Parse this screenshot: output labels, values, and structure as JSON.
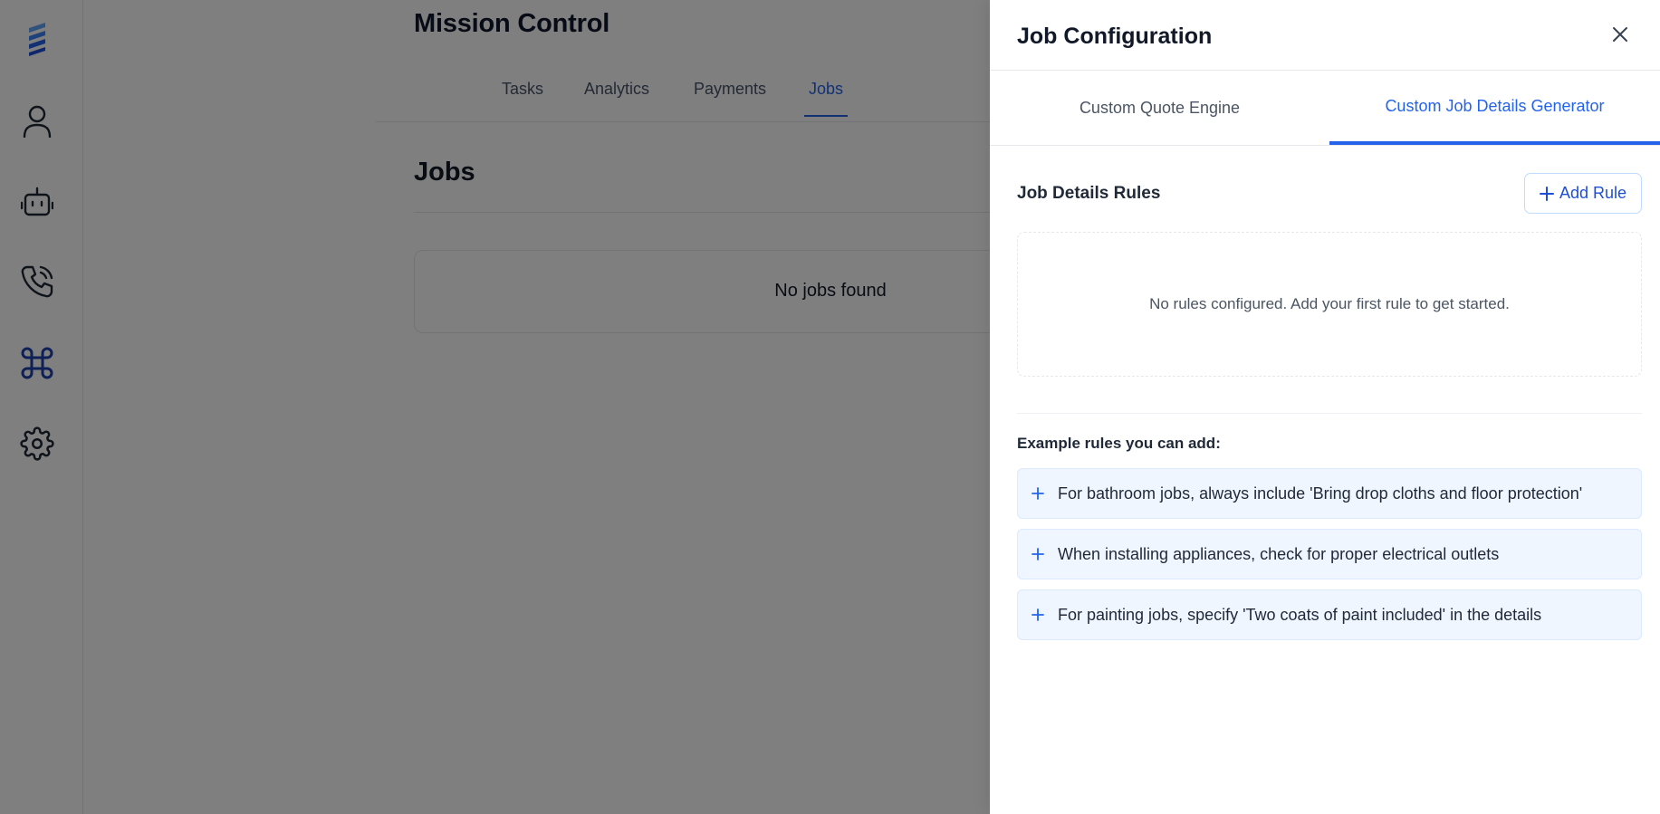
{
  "page": {
    "title": "Mission Control",
    "tabs": [
      {
        "label": "Tasks"
      },
      {
        "label": "Analytics"
      },
      {
        "label": "Payments"
      },
      {
        "label": "Jobs",
        "active": true
      }
    ],
    "section_title": "Jobs",
    "empty_message": "No jobs found"
  },
  "sidebar": {
    "items": [
      {
        "icon": "logo-icon"
      },
      {
        "icon": "user-icon"
      },
      {
        "icon": "bot-icon"
      },
      {
        "icon": "phone-call-icon"
      },
      {
        "icon": "command-icon",
        "active": true
      },
      {
        "icon": "gear-icon"
      }
    ]
  },
  "drawer": {
    "title": "Job Configuration",
    "tabs": [
      {
        "label": "Custom Quote Engine"
      },
      {
        "label": "Custom Job Details Generator",
        "active": true
      }
    ],
    "rules_heading": "Job Details Rules",
    "add_rule_label": "Add Rule",
    "rules_empty": "No rules configured. Add your first rule to get started.",
    "examples_heading": "Example rules you can add:",
    "examples": [
      {
        "text": "For bathroom jobs, always include 'Bring drop cloths and floor protection'"
      },
      {
        "text": "When installing appliances, check for proper electrical outlets"
      },
      {
        "text": "For painting jobs, specify 'Two coats of paint included' in the details"
      }
    ]
  },
  "colors": {
    "accent": "#2563eb",
    "overlay": "rgba(0,0,0,0.5)",
    "example_bg": "#eff6ff"
  }
}
